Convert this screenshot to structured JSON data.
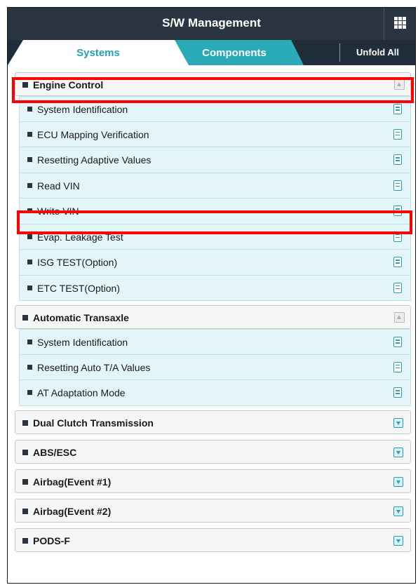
{
  "header": {
    "title": "S/W Management",
    "menu_icon": "grid-icon"
  },
  "tabs": [
    {
      "label": "Systems",
      "active": true
    },
    {
      "label": "Components",
      "active": false
    }
  ],
  "unfold_all_label": "Unfold All",
  "colors": {
    "titlebar": "#2b3542",
    "tabbar": "#1f2e3a",
    "accent": "#2a9fb4",
    "components_tab": "#2baab8",
    "sub_row_bg": "#e4f5f9",
    "highlight": "#ff0000"
  },
  "sections": [
    {
      "label": "Engine Control",
      "expanded": true,
      "highlighted": true,
      "items": [
        {
          "label": "System Identification"
        },
        {
          "label": "ECU Mapping Verification"
        },
        {
          "label": "Resetting Adaptive Values"
        },
        {
          "label": "Read VIN"
        },
        {
          "label": "Write VIN",
          "highlighted": true
        },
        {
          "label": "Evap. Leakage Test"
        },
        {
          "label": "ISG TEST(Option)"
        },
        {
          "label": "ETC TEST(Option)"
        }
      ]
    },
    {
      "label": "Automatic Transaxle",
      "expanded": true,
      "items": [
        {
          "label": "System Identification"
        },
        {
          "label": "Resetting Auto T/A Values"
        },
        {
          "label": "AT Adaptation Mode"
        }
      ]
    },
    {
      "label": "Dual Clutch Transmission",
      "expanded": false
    },
    {
      "label": "ABS/ESC",
      "expanded": false
    },
    {
      "label": "Airbag(Event #1)",
      "expanded": false
    },
    {
      "label": "Airbag(Event #2)",
      "expanded": false
    },
    {
      "label": "PODS-F",
      "expanded": false
    }
  ]
}
